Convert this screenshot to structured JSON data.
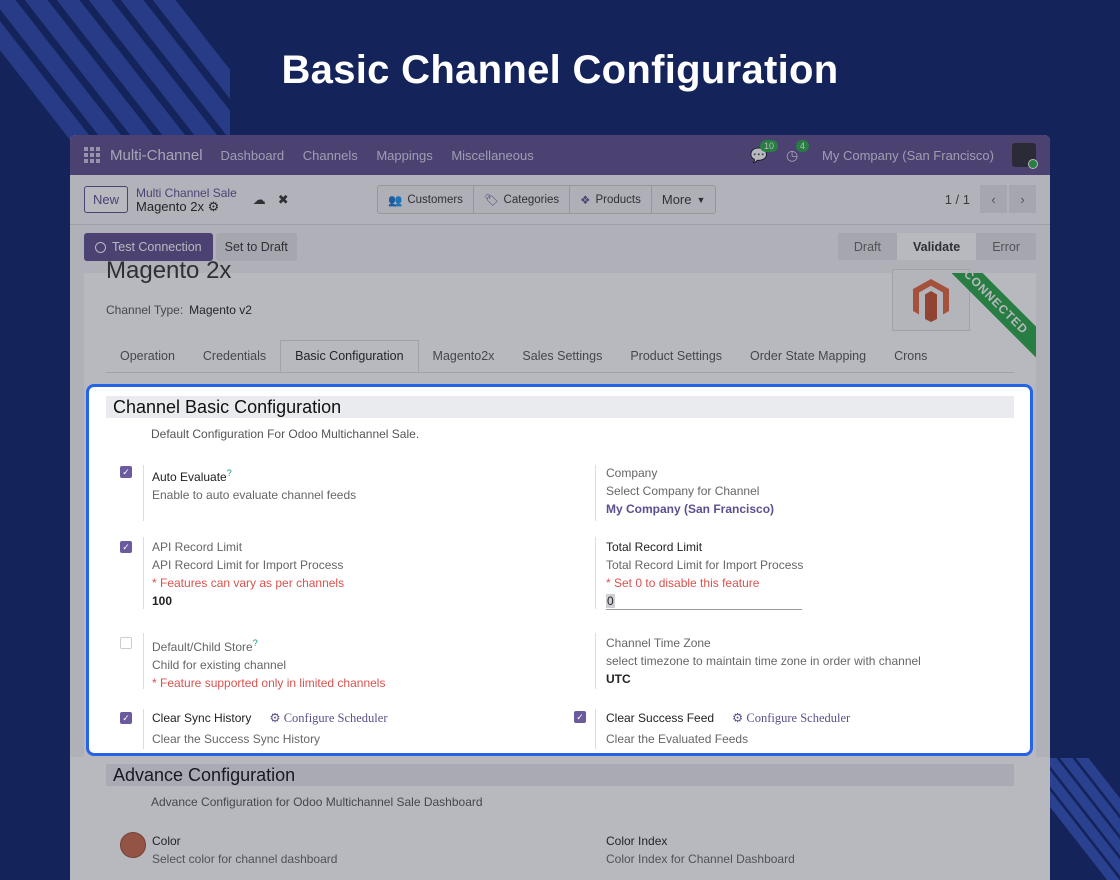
{
  "hero_title": "Basic Channel Configuration",
  "topbar": {
    "brand": "Multi-Channel",
    "menu": [
      "Dashboard",
      "Channels",
      "Mappings",
      "Miscellaneous"
    ],
    "chat_badge": "10",
    "activity_badge": "4",
    "company": "My Company (San Francisco)"
  },
  "control": {
    "new_label": "New",
    "breadcrumb_parent": "Multi Channel Sale",
    "breadcrumb_current": "Magento 2x",
    "smart_buttons": [
      "Customers",
      "Categories",
      "Products"
    ],
    "more_label": "More",
    "pager": "1 / 1"
  },
  "actions": {
    "test_connection": "Test Connection",
    "set_draft": "Set to Draft",
    "status_steps": [
      "Draft",
      "Validate",
      "Error"
    ],
    "status_current": "Validate"
  },
  "record": {
    "title": "Magento 2x",
    "channel_type_label": "Channel Type:",
    "channel_type_value": "Magento v2",
    "ribbon": "CONNECTED",
    "tabs": [
      "Operation",
      "Credentials",
      "Basic Configuration",
      "Magento2x",
      "Sales Settings",
      "Product Settings",
      "Order State Mapping",
      "Crons"
    ],
    "active_tab": "Basic Configuration"
  },
  "basic": {
    "heading": "Channel Basic Configuration",
    "description": "Default Configuration For Odoo Multichannel Sale.",
    "auto_evaluate": {
      "label": "Auto Evaluate",
      "help": "Enable to auto evaluate channel feeds",
      "checked": true
    },
    "company": {
      "label": "Company",
      "help": "Select Company for Channel",
      "value": "My Company (San Francisco)"
    },
    "api_limit": {
      "label": "API Record Limit",
      "help": "API Record Limit for Import Process",
      "note": "* Features can vary as per channels",
      "value": "100",
      "checked": true
    },
    "total_limit": {
      "label": "Total Record Limit",
      "help": "Total Record Limit for Import Process",
      "note": "* Set 0 to disable this feature",
      "value": "0"
    },
    "child_store": {
      "label": "Default/Child Store",
      "help": "Child for existing channel",
      "note": "* Feature supported only in limited channels",
      "checked": false
    },
    "time_zone": {
      "label": "Channel Time Zone",
      "help": "select timezone to maintain time zone in order with channel",
      "value": "UTC"
    },
    "clear_sync": {
      "label": "Clear Sync History",
      "scheduler": "Configure Scheduler",
      "help": "Clear the Success Sync History",
      "checked": true
    },
    "clear_feed": {
      "label": "Clear Success Feed",
      "scheduler": "Configure Scheduler",
      "help": "Clear the Evaluated Feeds",
      "checked": true
    }
  },
  "advance": {
    "heading": "Advance Configuration",
    "description": "Advance Configuration for Odoo Multichannel Sale Dashboard",
    "color": {
      "label": "Color",
      "help": "Select color for channel dashboard"
    },
    "color_index": {
      "label": "Color Index",
      "help": "Color Index for Channel Dashboard"
    }
  }
}
